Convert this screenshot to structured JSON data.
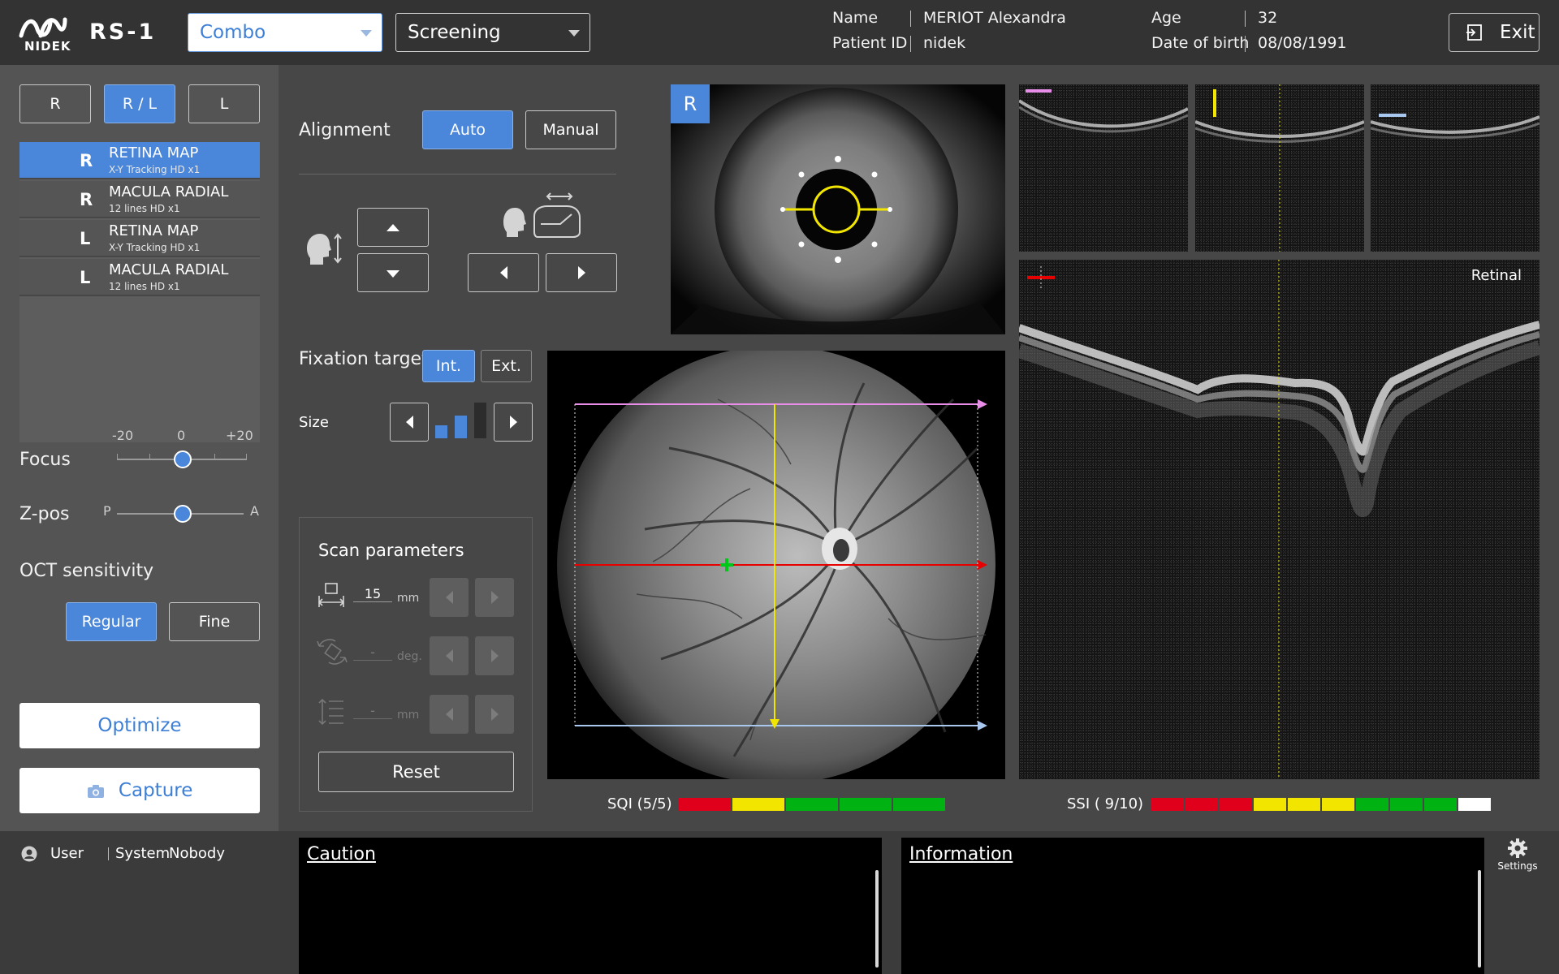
{
  "header": {
    "brand": "NIDEK",
    "product": "RS-1",
    "mode_select": "Combo",
    "exam_type_select": "Screening",
    "patient": {
      "name_label": "Name",
      "name_value": "MERIOT  Alexandra",
      "id_label": "Patient ID",
      "id_value": "nidek",
      "age_label": "Age",
      "age_value": "32",
      "dob_label": "Date of birth",
      "dob_value": "08/08/1991"
    },
    "exit_label": "Exit"
  },
  "eye_select": {
    "right": "R",
    "both": "R / L",
    "left": "L",
    "selected": "R / L"
  },
  "scan_list": [
    {
      "eye": "R",
      "name": "RETINA MAP",
      "sub": "X-Y  Tracking HD  x1",
      "selected": true
    },
    {
      "eye": "R",
      "name": "MACULA RADIAL",
      "sub": "12 lines  HD  x1",
      "selected": false
    },
    {
      "eye": "L",
      "name": "RETINA MAP",
      "sub": "X-Y  Tracking HD  x1",
      "selected": false
    },
    {
      "eye": "L",
      "name": "MACULA RADIAL",
      "sub": "12 lines  HD  x1",
      "selected": false
    }
  ],
  "focus": {
    "label": "Focus",
    "min_label": "-20",
    "mid_label": "0",
    "max_label": "+20",
    "value": 0
  },
  "zpos": {
    "label": "Z-pos",
    "min_label": "P",
    "max_label": "A",
    "value": 0.5
  },
  "oct_sensitivity": {
    "label": "OCT sensitivity",
    "regular": "Regular",
    "fine": "Fine",
    "selected": "Regular"
  },
  "optimize_label": "Optimize",
  "capture_label": "Capture",
  "alignment": {
    "label": "Alignment",
    "auto": "Auto",
    "manual": "Manual",
    "selected": "Auto"
  },
  "fixation": {
    "label": "Fixation target",
    "int": "Int.",
    "ext": "Ext.",
    "selected": "Int.",
    "size_label": "Size",
    "size_level": 2,
    "size_max": 3
  },
  "scan_parameters": {
    "title": "Scan parameters",
    "length_value": "15",
    "length_unit": "mm",
    "angle_value": "-",
    "angle_unit": "deg.",
    "spacing_value": "-",
    "spacing_unit": "mm",
    "reset_label": "Reset"
  },
  "anterior_image": {
    "eye_badge": "R"
  },
  "bscan": {
    "label": "Retinal"
  },
  "sqi": {
    "label": "SQI (5/5)",
    "segments": [
      "#e0001b",
      "#f2e600",
      "#00b312",
      "#00b312",
      "#00b312"
    ]
  },
  "ssi": {
    "label": "SSI (  9/10)",
    "segments": [
      "#e0001b",
      "#e0001b",
      "#e0001b",
      "#f2e600",
      "#f2e600",
      "#f2e600",
      "#00b312",
      "#00b312",
      "#00b312",
      "#ffffff"
    ]
  },
  "footer": {
    "user_label": "User",
    "system_label": "System",
    "system_user": "Nobody",
    "caution_title": "Caution",
    "information_title": "Information",
    "settings_label": "Settings"
  },
  "colors": {
    "accent": "#4a86d9",
    "scan_top": "#e98ee8",
    "scan_mid": "#e60000",
    "scan_bottom": "#a9c8f0",
    "scan_vertical": "#f2e600"
  }
}
